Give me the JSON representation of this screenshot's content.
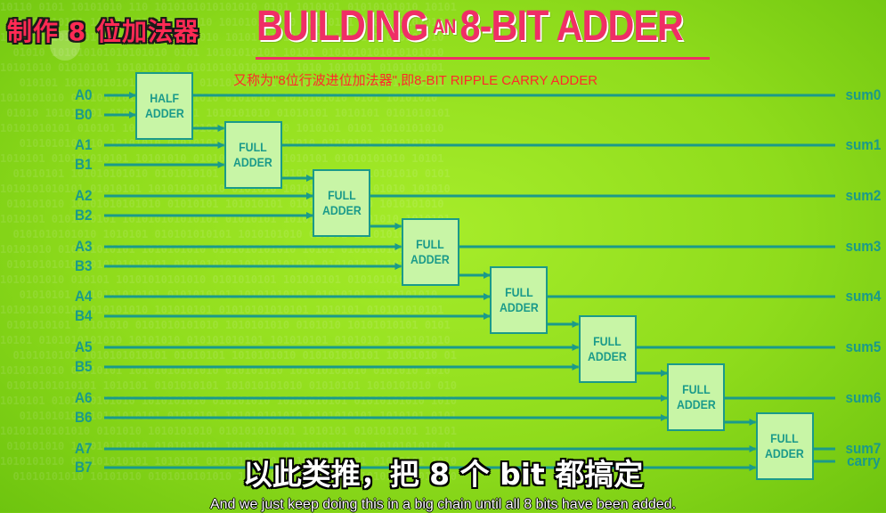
{
  "header": {
    "title_cn": "制作 8 位加法器",
    "title_en_part1": "BUILDING",
    "title_en_an": "AN",
    "title_en_part2": "8-BIT ADDER",
    "subtitle": "又称为\"8位行波进位加法器\",即8-BIT RIPPLE CARRY ADDER"
  },
  "inputs": [
    "A0",
    "B0",
    "A1",
    "B1",
    "A2",
    "B2",
    "A3",
    "B3",
    "A4",
    "B4",
    "A5",
    "B5",
    "A6",
    "B6",
    "A7",
    "B7"
  ],
  "adders": [
    {
      "line1": "HALF",
      "line2": "ADDER"
    },
    {
      "line1": "FULL",
      "line2": "ADDER"
    },
    {
      "line1": "FULL",
      "line2": "ADDER"
    },
    {
      "line1": "FULL",
      "line2": "ADDER"
    },
    {
      "line1": "FULL",
      "line2": "ADDER"
    },
    {
      "line1": "FULL",
      "line2": "ADDER"
    },
    {
      "line1": "FULL",
      "line2": "ADDER"
    },
    {
      "line1": "FULL",
      "line2": "ADDER"
    }
  ],
  "outputs": [
    "sum0",
    "sum1",
    "sum2",
    "sum3",
    "sum4",
    "sum5",
    "sum6",
    "sum7",
    "carry"
  ],
  "captions": {
    "cn": "以此类推，把 8 个 bit 都搞定",
    "en": "And we just keep doing this in a big chain until all 8 bits have been added."
  },
  "colors": {
    "wire": "#1a9a8a",
    "box_fill": "#c8f5a6",
    "title": "#ef2e66",
    "subtitle": "#ff2a2a"
  }
}
